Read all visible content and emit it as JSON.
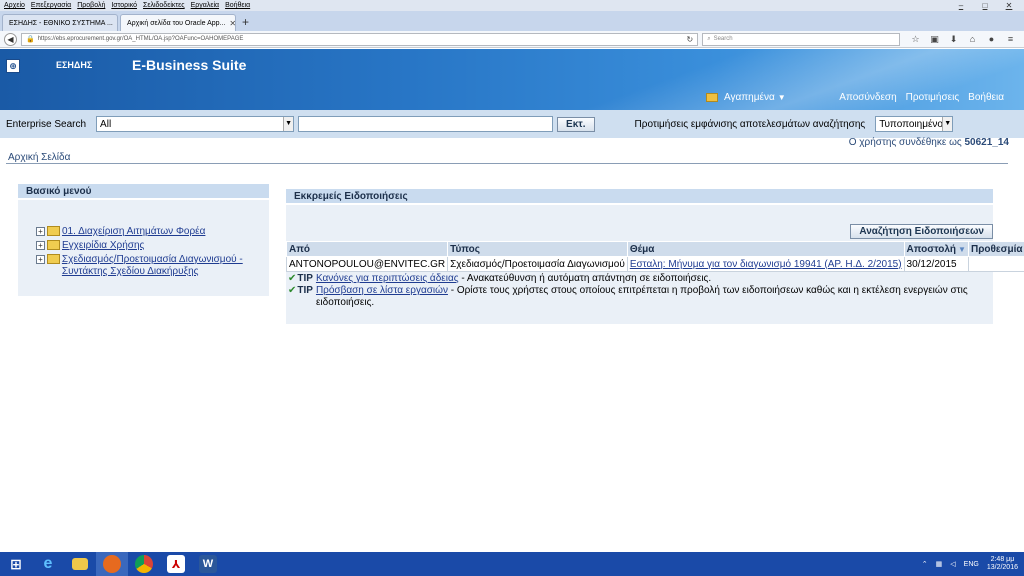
{
  "browser": {
    "menu": [
      "Αρχείο",
      "Επεξεργασία",
      "Προβολή",
      "Ιστορικό",
      "Σελιδοδείκτες",
      "Εργαλεία",
      "Βοήθεια"
    ],
    "tabs": [
      {
        "label": "ΕΣΗΔΗΣ - ΕΘΝΙΚΟ ΣΥΣΤΗΜΑ ..."
      },
      {
        "label": "Αρχική σελίδα του Oracle App..."
      }
    ],
    "url": "https://ebs.eprocurement.gov.gr/OA_HTML/OA.jsp?OAFunc=OAHOMEPAGE",
    "search_placeholder": "Search"
  },
  "header": {
    "logo_text": "ΕΣΗΔΗΣ",
    "suite_title": "E-Business Suite",
    "favorites": "Αγαπημένα",
    "links": [
      "Αποσύνδεση",
      "Προτιμήσεις",
      "Βοήθεια"
    ]
  },
  "search": {
    "label": "Enterprise Search",
    "scope_value": "All",
    "query_value": "",
    "go_label": "Εκτ.",
    "prefs_label": "Προτιμήσεις εμφάνισης αποτελεσμάτων αναζήτησης",
    "prefs_value": "Τυποποιημένο"
  },
  "user": {
    "logged_in_text": "Ο χρήστης συνδέθηκε ως",
    "username": "50621_14"
  },
  "page_title": "Αρχική Σελίδα",
  "main_menu": {
    "title": "Βασικό μενού",
    "items": [
      "01. Διαχείριση Αιτημάτων Φορέα",
      "Εγχειρίδια Χρήσης",
      "Σχεδιασμός/Προετοιμασία Διαγωνισμού - Συντάκτης Σχεδίου Διακήρυξης"
    ]
  },
  "notifications": {
    "title": "Εκκρεμείς Ειδοποιήσεις",
    "search_button": "Αναζήτηση Ειδοποιήσεων",
    "columns": [
      "Από",
      "Τύπος",
      "Θέμα",
      "Αποστολή",
      "Προθεσμία"
    ],
    "rows": [
      {
        "from": "ANTONOPOULOU@ENVITEC.GR",
        "type": "Σχεδιασμός/Προετοιμασία Διαγωνισμού",
        "subject": "Εσταλη: Μήνυμα για τον διαγωνισμό 19941 (ΑΡ. Η.Δ. 2/2015)",
        "sent": "30/12/2015",
        "due": ""
      }
    ],
    "tips": [
      {
        "label": "TIP",
        "link": "Κανόνες για περιπτώσεις άδειας",
        "text": " - Ανακατεύθυνση ή αυτόματη απάντηση σε ειδοποιήσεις."
      },
      {
        "label": "TIP",
        "link": "Πρόσβαση σε λίστα εργασιών",
        "text": " - Ορίστε τους χρήστες στους οποίους επιτρέπεται η προβολή των ειδοποιήσεων καθώς και η εκτέλεση ενεργειών στις ειδοποιήσεις."
      }
    ]
  },
  "taskbar": {
    "language": "ENG",
    "time": "2:48 μμ",
    "date": "13/2/2016"
  }
}
